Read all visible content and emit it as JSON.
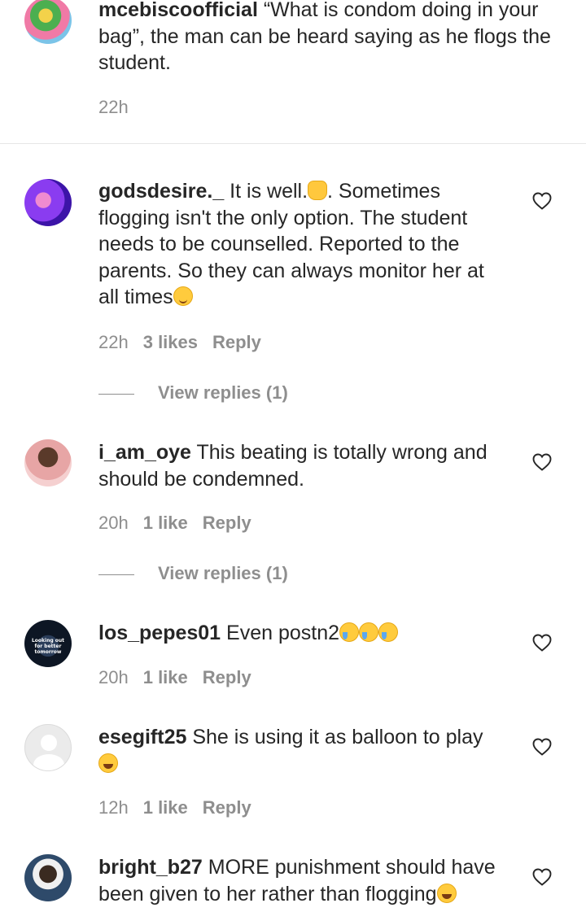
{
  "comments": [
    {
      "username": "mcebiscoofficial",
      "text": " “What is condom doing in your bag”, the man can be heard saying as he flogs the student.",
      "time": "22h"
    },
    {
      "username": "godsdesire._",
      "text_a": " It is well.",
      "emoji_a": "raising-hands-emoji",
      "text_b": ". Sometimes flogging isn't the only option. The student needs to be counselled. Reported to the parents. So they can always monitor her at all times",
      "emoji_b": "slightly-smiling-emoji",
      "time": "22h",
      "likes": "3 likes",
      "reply": "Reply",
      "view_replies": "View replies (1)"
    },
    {
      "username": "i_am_oye",
      "text": " This beating is totally wrong and should be condemned.",
      "time": "20h",
      "likes": "1 like",
      "reply": "Reply",
      "view_replies": "View replies (1)"
    },
    {
      "username": "los_pepes01",
      "text": " Even postn2",
      "emoji": "crying-face-emoji",
      "avatar_text": "Looking out for better tomorrow",
      "time": "20h",
      "likes": "1 like",
      "reply": "Reply"
    },
    {
      "username": "esegift25",
      "text": " She is using it as balloon to play ",
      "emoji": "face-with-tears-of-joy-emoji",
      "time": "12h",
      "likes": "1 like",
      "reply": "Reply"
    },
    {
      "username": "bright_b27",
      "text": " MORE punishment should have been given to her rather than flogging",
      "emoji": "face-with-tears-of-joy-emoji"
    }
  ],
  "colors": {
    "text": "#262626",
    "meta": "#8e8e8e",
    "divider": "#e6e6e6"
  },
  "icons": {
    "like": "heart-outline-icon"
  }
}
